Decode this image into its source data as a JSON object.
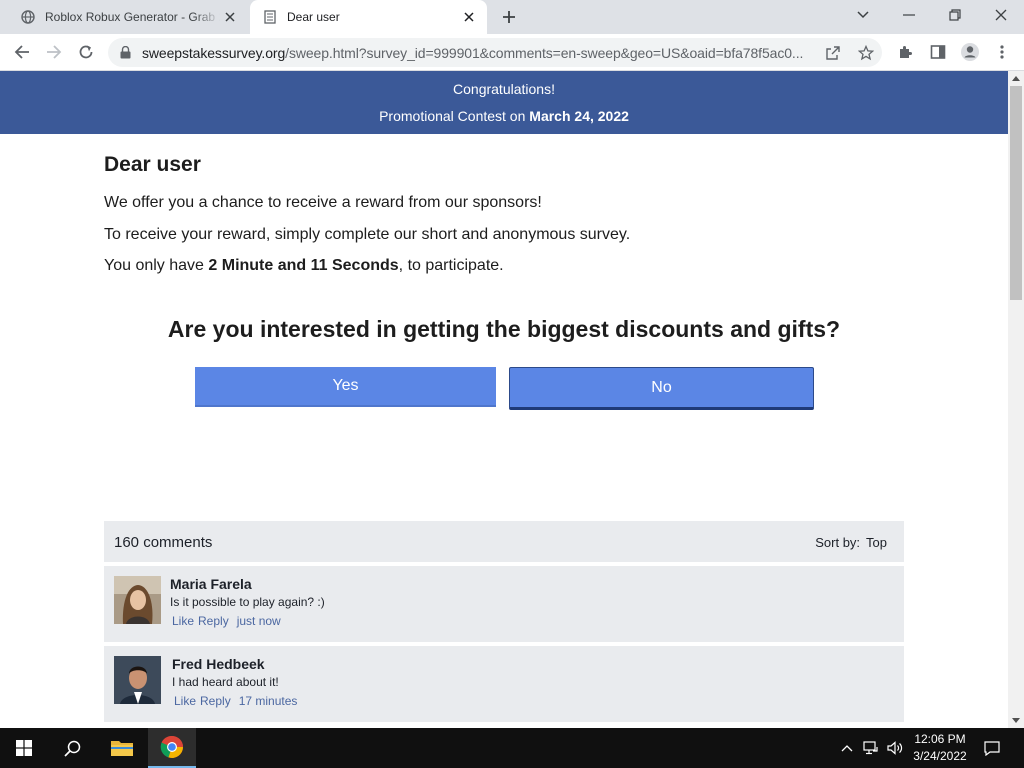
{
  "browser": {
    "tabs": [
      {
        "title": "Roblox Robux Generator - Grab 2",
        "active": false,
        "favicon": "globe-icon"
      },
      {
        "title": "Dear user",
        "active": true,
        "favicon": "document-icon"
      }
    ],
    "url": {
      "host": "sweepstakessurvey.org",
      "path": "/sweep.html?survey_id=999901&comments=en-sweep&geo=US&oaid=bfa78f5ac0..."
    }
  },
  "banner": {
    "line1": "Congratulations!",
    "line2_prefix": "Promotional Contest on ",
    "line2_date": "March 24, 2022"
  },
  "page": {
    "greeting": "Dear user",
    "para1": "We offer you a chance to receive a reward from our sponsors!",
    "para2": "To receive your reward, simply complete our short and anonymous survey.",
    "para3_prefix": "You only have ",
    "para3_time": "2 Minute and 11 Seconds",
    "para3_suffix": ", to participate.",
    "question": "Are you interested in getting the biggest discounts and gifts?",
    "yes_label": "Yes",
    "no_label": "No"
  },
  "comments": {
    "count_label": "160 comments",
    "sort_label": "Sort by:",
    "sort_value": "Top",
    "items": [
      {
        "name": "Maria Farela",
        "text": "Is it possible to play again? :)",
        "like": "Like",
        "reply": "Reply",
        "time": "just now"
      },
      {
        "name": "Fred Hedbeek",
        "text": "I had heard about it!",
        "like": "Like",
        "reply": "Reply",
        "time": "17 minutes"
      }
    ]
  },
  "taskbar": {
    "time": "12:06 PM",
    "date": "3/24/2022"
  },
  "colors": {
    "banner": "#3b5998",
    "button": "#5b86e5",
    "comment_bg": "#e9ebee",
    "link": "#4b67a1"
  }
}
